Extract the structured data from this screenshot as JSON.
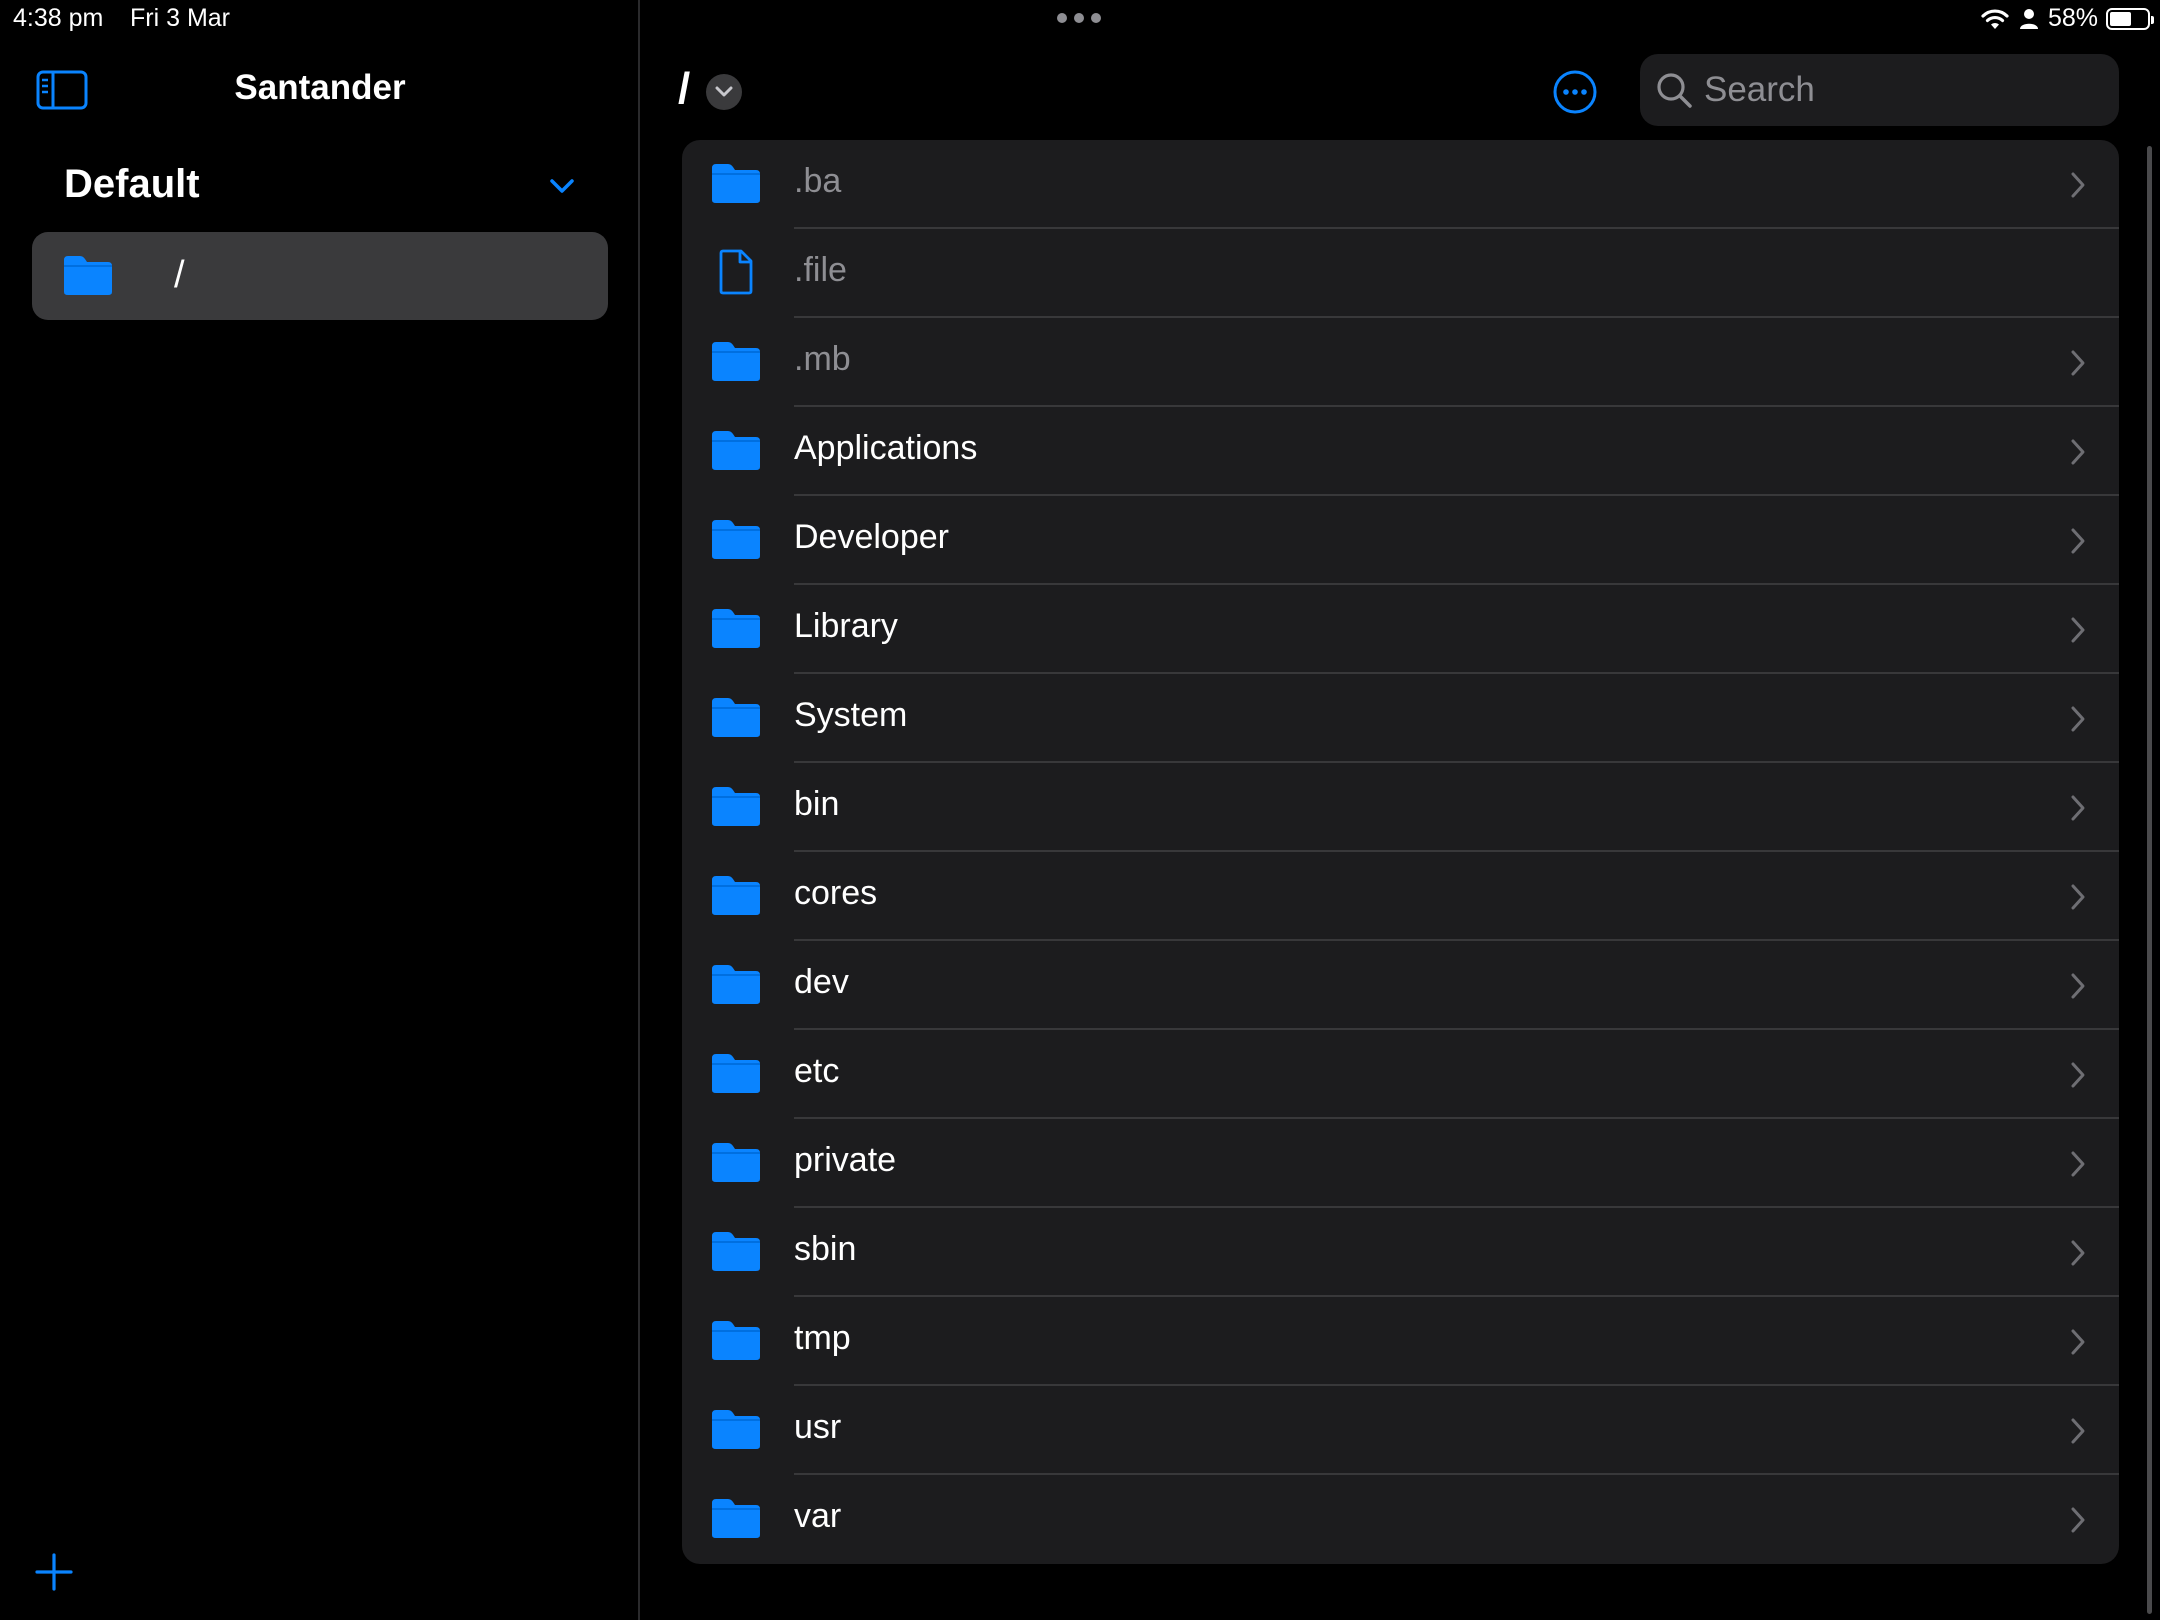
{
  "status_bar": {
    "time": "4:38 pm",
    "date": "Fri 3 Mar",
    "battery_percent": "58%",
    "battery_level": 0.58
  },
  "sidebar": {
    "title": "Santander",
    "section_title": "Default",
    "items": [
      {
        "label": "/",
        "icon": "folder-icon",
        "selected": true
      }
    ]
  },
  "main": {
    "title": "/",
    "search": {
      "placeholder": "Search",
      "value": ""
    },
    "rows": [
      {
        "label": ".ba",
        "type": "folder",
        "hidden": true
      },
      {
        "label": ".file",
        "type": "file",
        "hidden": true
      },
      {
        "label": ".mb",
        "type": "folder",
        "hidden": true
      },
      {
        "label": "Applications",
        "type": "folder",
        "hidden": false
      },
      {
        "label": "Developer",
        "type": "folder",
        "hidden": false
      },
      {
        "label": "Library",
        "type": "folder",
        "hidden": false
      },
      {
        "label": "System",
        "type": "folder",
        "hidden": false
      },
      {
        "label": "bin",
        "type": "folder",
        "hidden": false
      },
      {
        "label": "cores",
        "type": "folder",
        "hidden": false
      },
      {
        "label": "dev",
        "type": "folder",
        "hidden": false
      },
      {
        "label": "etc",
        "type": "folder",
        "hidden": false
      },
      {
        "label": "private",
        "type": "folder",
        "hidden": false
      },
      {
        "label": "sbin",
        "type": "folder",
        "hidden": false
      },
      {
        "label": "tmp",
        "type": "folder",
        "hidden": false
      },
      {
        "label": "usr",
        "type": "folder",
        "hidden": false
      },
      {
        "label": "var",
        "type": "folder",
        "hidden": false
      }
    ]
  },
  "colors": {
    "accent": "#0a84ff",
    "background": "#000000",
    "list_background": "#1c1c1e",
    "selected_background": "#3a3a3c",
    "secondary_text": "#8e8e93"
  }
}
